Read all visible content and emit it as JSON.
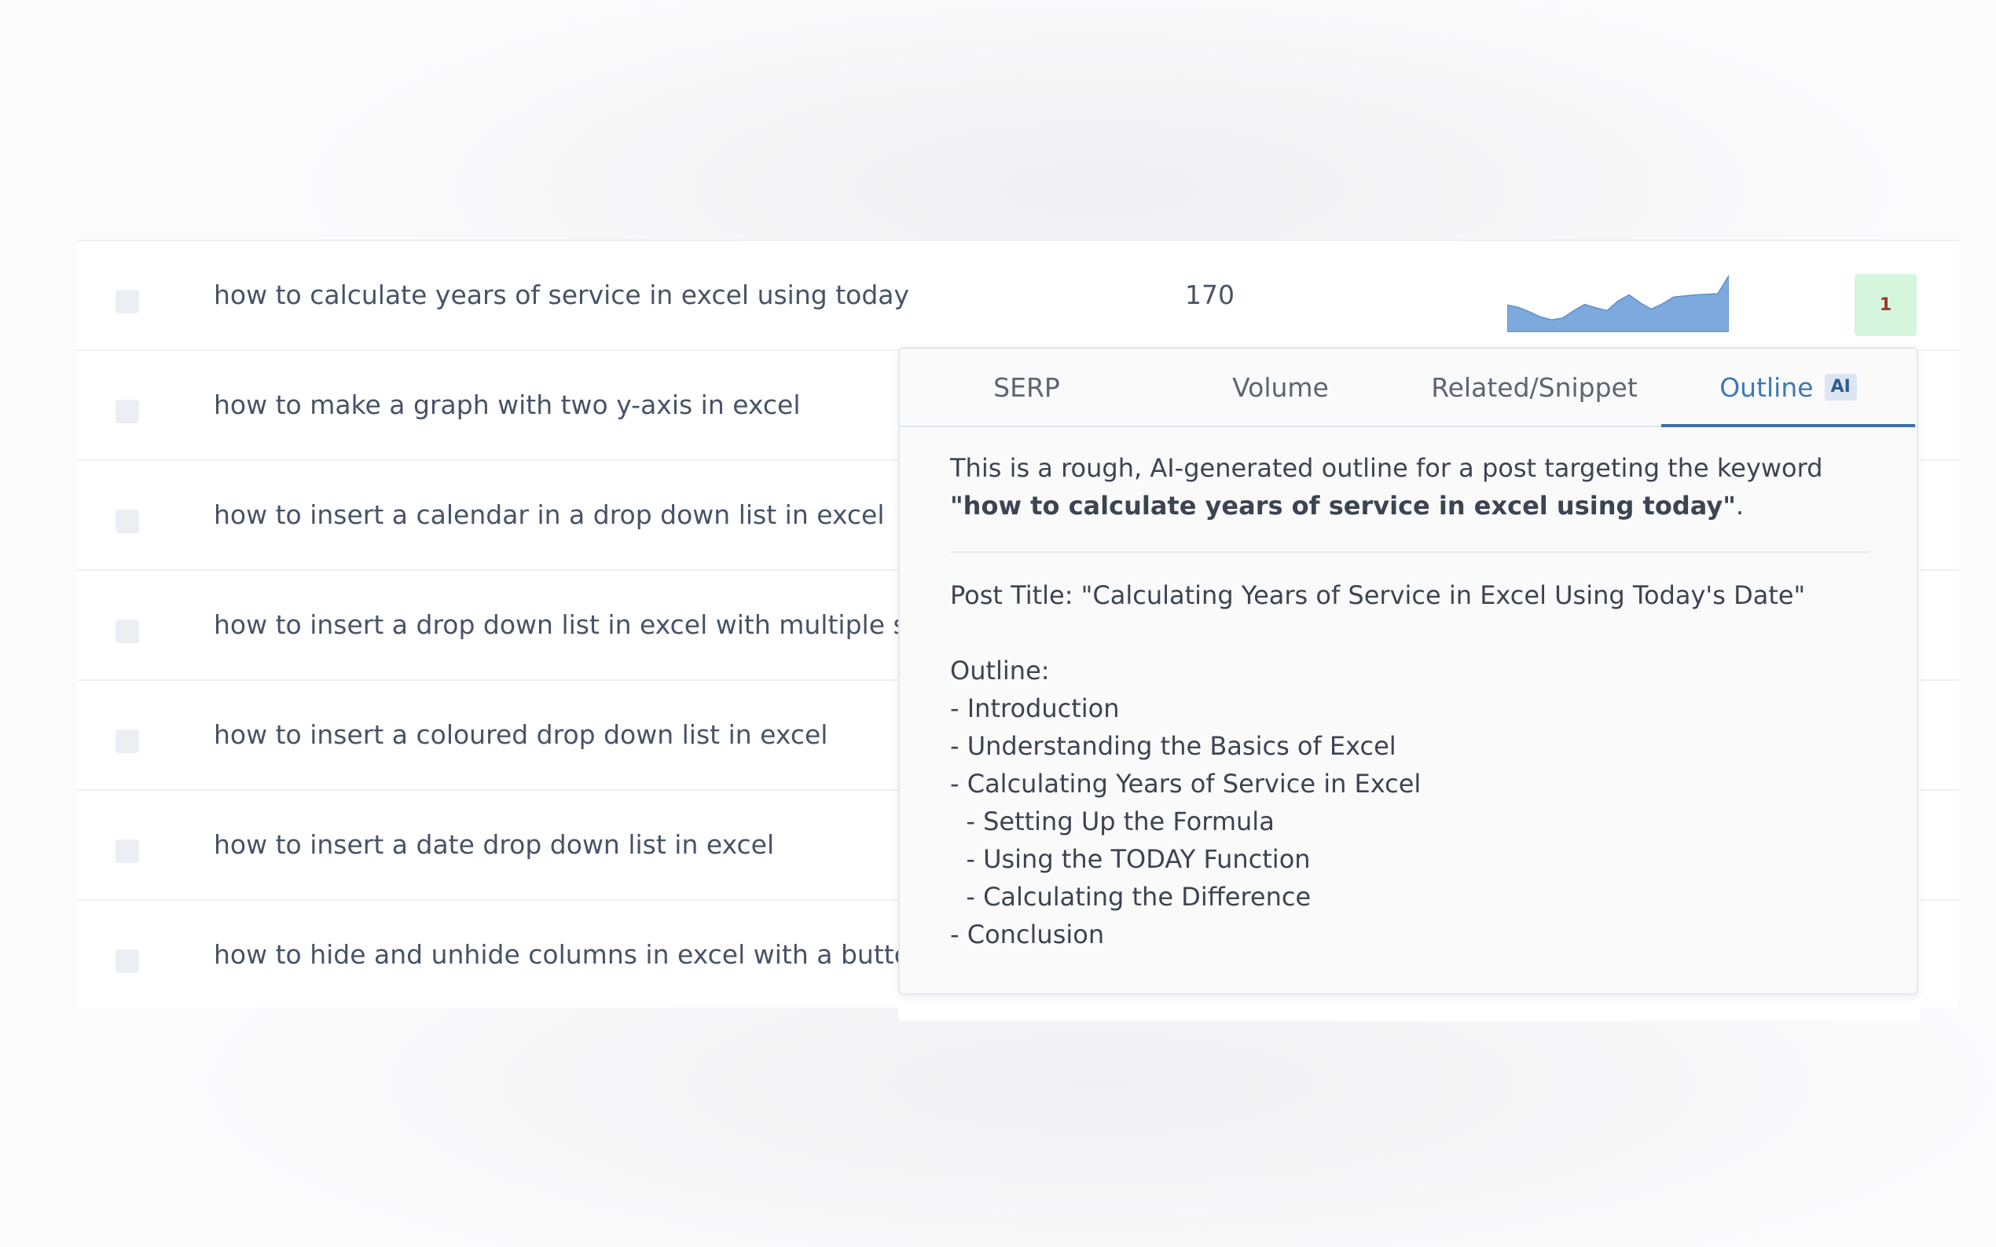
{
  "rows": [
    {
      "keyword": "how to calculate years of service in excel using today",
      "volume": "170",
      "badge": "1"
    },
    {
      "keyword": "how to make a graph with two y-axis in excel"
    },
    {
      "keyword": "how to insert a calendar in a drop down list in excel"
    },
    {
      "keyword": "how to insert a drop down list in excel with multiple se"
    },
    {
      "keyword": "how to insert a coloured drop down list in excel"
    },
    {
      "keyword": "how to insert a date drop down list in excel"
    },
    {
      "keyword": "how to hide and unhide columns in excel with a buttor"
    }
  ],
  "trend_values": [
    0.48,
    0.44,
    0.36,
    0.27,
    0.22,
    0.25,
    0.38,
    0.49,
    0.43,
    0.38,
    0.55,
    0.66,
    0.52,
    0.41,
    0.5,
    0.62,
    0.64,
    0.66,
    0.67,
    0.68,
    1.0
  ],
  "colors": {
    "trend_fill": "#7ea9dc",
    "trend_stroke": "#5f8fd0",
    "badge_bg": "#d3f6dd",
    "badge_text": "#a3332b",
    "active_tab": "#3d78b8"
  },
  "popover": {
    "tabs": [
      {
        "label": "SERP"
      },
      {
        "label": "Volume"
      },
      {
        "label": "Related/Snippet"
      },
      {
        "label": "Outline",
        "badge": "AI",
        "active": true
      }
    ],
    "intro_prefix": "This is a rough, AI-generated outline for a post targeting the keyword",
    "intro_keyword": "\"how to calculate years of service in excel using today\"",
    "intro_suffix": ".",
    "post_title": "Post Title: \"Calculating Years of Service in Excel Using Today's Date\"",
    "outline_label": "Outline:",
    "outline_items": [
      "- Introduction",
      "- Understanding the Basics of Excel",
      "- Calculating Years of Service in Excel",
      "  - Setting Up the Formula",
      "  - Using the TODAY Function",
      "  - Calculating the Difference",
      "- Conclusion"
    ]
  }
}
